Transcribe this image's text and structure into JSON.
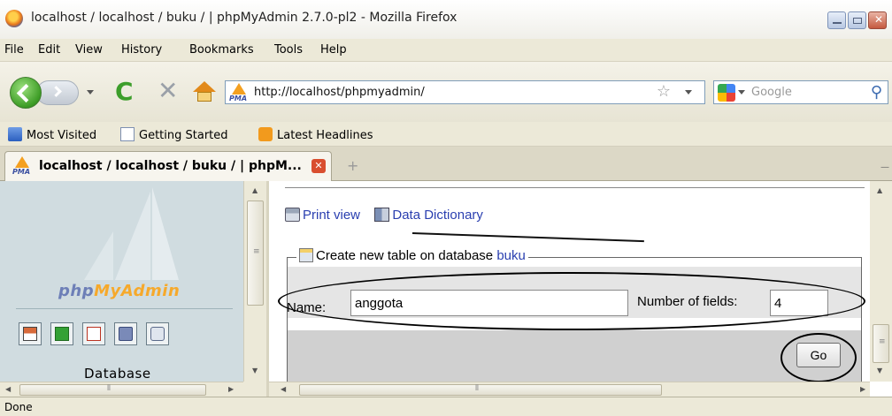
{
  "window": {
    "title": "localhost / localhost / buku / | phpMyAdmin 2.7.0-pl2 - Mozilla Firefox"
  },
  "menu": {
    "items": [
      "File",
      "Edit",
      "View",
      "History",
      "Bookmarks",
      "Tools",
      "Help"
    ]
  },
  "navigation": {
    "url": "http://localhost/phpmyadmin/",
    "search_placeholder": "Google"
  },
  "bookmarks": [
    "Most Visited",
    "Getting Started",
    "Latest Headlines"
  ],
  "tab": {
    "title": "localhost / localhost / buku / | phpM..."
  },
  "left_panel": {
    "logo_php": "php",
    "logo_my": "My",
    "logo_admin": "Admin",
    "database_label": "Database"
  },
  "main": {
    "print_view": "Print view",
    "data_dictionary": "Data Dictionary",
    "create_table_prefix": "Create new table on database",
    "database_name": "buku",
    "name_label": "Name:",
    "name_value": "anggota",
    "fields_label": "Number of fields:",
    "fields_value": "4",
    "go_label": "Go"
  },
  "status": {
    "text": "Done"
  },
  "colors": {
    "link": "#2a3fb0",
    "left_frame": "#d0dce0",
    "chrome": "#ece9d8"
  }
}
